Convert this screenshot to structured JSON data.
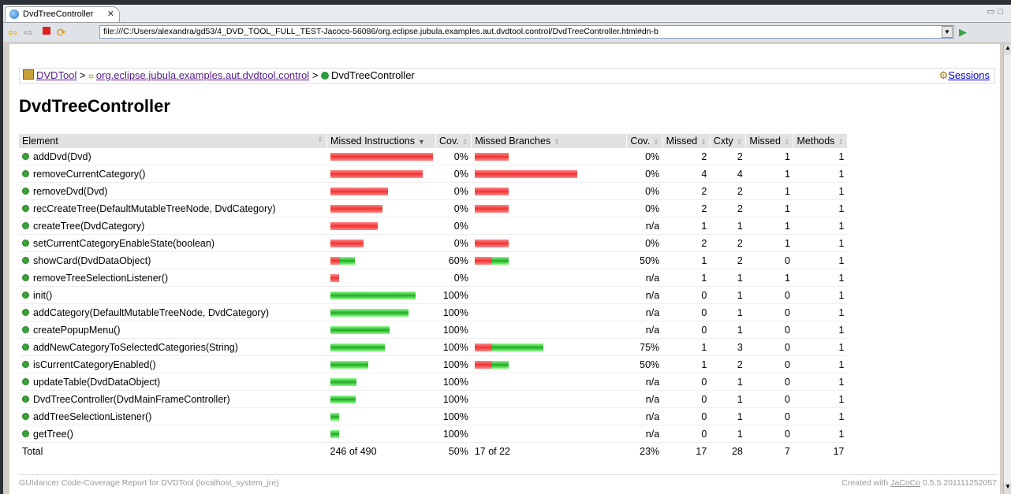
{
  "tab": {
    "title": "DvdTreeController"
  },
  "nav": {
    "url": "file:///C:/Users/alexandra/gd53/4_DVD_TOOL_FULL_TEST-Jacoco-56086/org.eclipse.jubula.examples.aut.dvdtool.control/DvdTreeController.html#dn-b"
  },
  "breadcrumb": {
    "root": "DVDTool",
    "package": "org.eclipse.jubula.examples.aut.dvdtool.control",
    "sep": ">",
    "current": "DvdTreeController",
    "sessions": "Sessions"
  },
  "page_title": "DvdTreeController",
  "table": {
    "headers": [
      "Element",
      "Missed Instructions",
      "Cov.",
      "Missed Branches",
      "Cov.",
      "Missed",
      "Cxty",
      "Missed",
      "Methods"
    ],
    "rows": [
      {
        "name": "addDvd(Dvd)",
        "instr": {
          "missed": 1.0,
          "total": 130
        },
        "cov": "0%",
        "br": {
          "missed": 2,
          "total": 2
        },
        "bcov": "0%",
        "mc": "2",
        "cx": "2",
        "mm": "1",
        "me": "1"
      },
      {
        "name": "removeCurrentCategory()",
        "instr": {
          "missed": 1.0,
          "total": 117
        },
        "cov": "0%",
        "br": {
          "missed": 6,
          "total": 6
        },
        "bcov": "0%",
        "mc": "4",
        "cx": "4",
        "mm": "1",
        "me": "1"
      },
      {
        "name": "removeDvd(Dvd)",
        "instr": {
          "missed": 1.0,
          "total": 73
        },
        "cov": "0%",
        "br": {
          "missed": 2,
          "total": 2
        },
        "bcov": "0%",
        "mc": "2",
        "cx": "2",
        "mm": "1",
        "me": "1"
      },
      {
        "name": "recCreateTree(DefaultMutableTreeNode, DvdCategory)",
        "instr": {
          "missed": 1.0,
          "total": 66
        },
        "cov": "0%",
        "br": {
          "missed": 2,
          "total": 2
        },
        "bcov": "0%",
        "mc": "2",
        "cx": "2",
        "mm": "1",
        "me": "1"
      },
      {
        "name": "createTree(DvdCategory)",
        "instr": {
          "missed": 1.0,
          "total": 60
        },
        "cov": "0%",
        "br": null,
        "bcov": "n/a",
        "mc": "1",
        "cx": "1",
        "mm": "1",
        "me": "1"
      },
      {
        "name": "setCurrentCategoryEnableState(boolean)",
        "instr": {
          "missed": 1.0,
          "total": 42
        },
        "cov": "0%",
        "br": {
          "missed": 2,
          "total": 2
        },
        "bcov": "0%",
        "mc": "2",
        "cx": "2",
        "mm": "1",
        "me": "1"
      },
      {
        "name": "showCard(DvdDataObject)",
        "instr": {
          "missed": 0.4,
          "total": 31
        },
        "cov": "60%",
        "br": {
          "missed": 1,
          "total": 2
        },
        "bcov": "50%",
        "mc": "1",
        "cx": "2",
        "mm": "0",
        "me": "1"
      },
      {
        "name": "removeTreeSelectionListener()",
        "instr": {
          "missed": 1.0,
          "total": 11
        },
        "cov": "0%",
        "br": null,
        "bcov": "n/a",
        "mc": "1",
        "cx": "1",
        "mm": "1",
        "me": "1"
      },
      {
        "name": "init()",
        "instr": {
          "missed": 0.0,
          "total": 108
        },
        "cov": "100%",
        "br": null,
        "bcov": "n/a",
        "mc": "0",
        "cx": "1",
        "mm": "0",
        "me": "1"
      },
      {
        "name": "addCategory(DefaultMutableTreeNode, DvdCategory)",
        "instr": {
          "missed": 0.0,
          "total": 99
        },
        "cov": "100%",
        "br": null,
        "bcov": "n/a",
        "mc": "0",
        "cx": "1",
        "mm": "0",
        "me": "1"
      },
      {
        "name": "createPopupMenu()",
        "instr": {
          "missed": 0.0,
          "total": 75
        },
        "cov": "100%",
        "br": null,
        "bcov": "n/a",
        "mc": "0",
        "cx": "1",
        "mm": "0",
        "me": "1"
      },
      {
        "name": "addNewCategoryToSelectedCategories(String)",
        "instr": {
          "missed": 0.0,
          "total": 69
        },
        "cov": "100%",
        "br": {
          "missed": 1,
          "total": 4
        },
        "bcov": "75%",
        "mc": "1",
        "cx": "3",
        "mm": "0",
        "me": "1"
      },
      {
        "name": "isCurrentCategoryEnabled()",
        "instr": {
          "missed": 0.0,
          "total": 48
        },
        "cov": "100%",
        "br": {
          "missed": 1,
          "total": 2
        },
        "bcov": "50%",
        "mc": "1",
        "cx": "2",
        "mm": "0",
        "me": "1"
      },
      {
        "name": "updateTable(DvdDataObject)",
        "instr": {
          "missed": 0.0,
          "total": 33
        },
        "cov": "100%",
        "br": null,
        "bcov": "n/a",
        "mc": "0",
        "cx": "1",
        "mm": "0",
        "me": "1"
      },
      {
        "name": "DvdTreeController(DvdMainFrameController)",
        "instr": {
          "missed": 0.0,
          "total": 32
        },
        "cov": "100%",
        "br": null,
        "bcov": "n/a",
        "mc": "0",
        "cx": "1",
        "mm": "0",
        "me": "1"
      },
      {
        "name": "addTreeSelectionListener()",
        "instr": {
          "missed": 0.0,
          "total": 11
        },
        "cov": "100%",
        "br": null,
        "bcov": "n/a",
        "mc": "0",
        "cx": "1",
        "mm": "0",
        "me": "1"
      },
      {
        "name": "getTree()",
        "instr": {
          "missed": 0.0,
          "total": 11
        },
        "cov": "100%",
        "br": null,
        "bcov": "n/a",
        "mc": "0",
        "cx": "1",
        "mm": "0",
        "me": "1"
      }
    ],
    "total": {
      "label": "Total",
      "instr": "246 of 490",
      "cov": "50%",
      "br": "17 of 22",
      "bcov": "23%",
      "mc": "17",
      "cx": "28",
      "mm": "7",
      "me": "17"
    }
  },
  "footer": {
    "left": "GUIdancer Code-Coverage Report for DVDTool (localhost_system_jre)",
    "right_prefix": "Created with",
    "right_link": "JaCoCo",
    "right_version": "0.5.5.201111252057"
  },
  "colors": {
    "missed": "#e33333",
    "covered": "#22aa22"
  }
}
